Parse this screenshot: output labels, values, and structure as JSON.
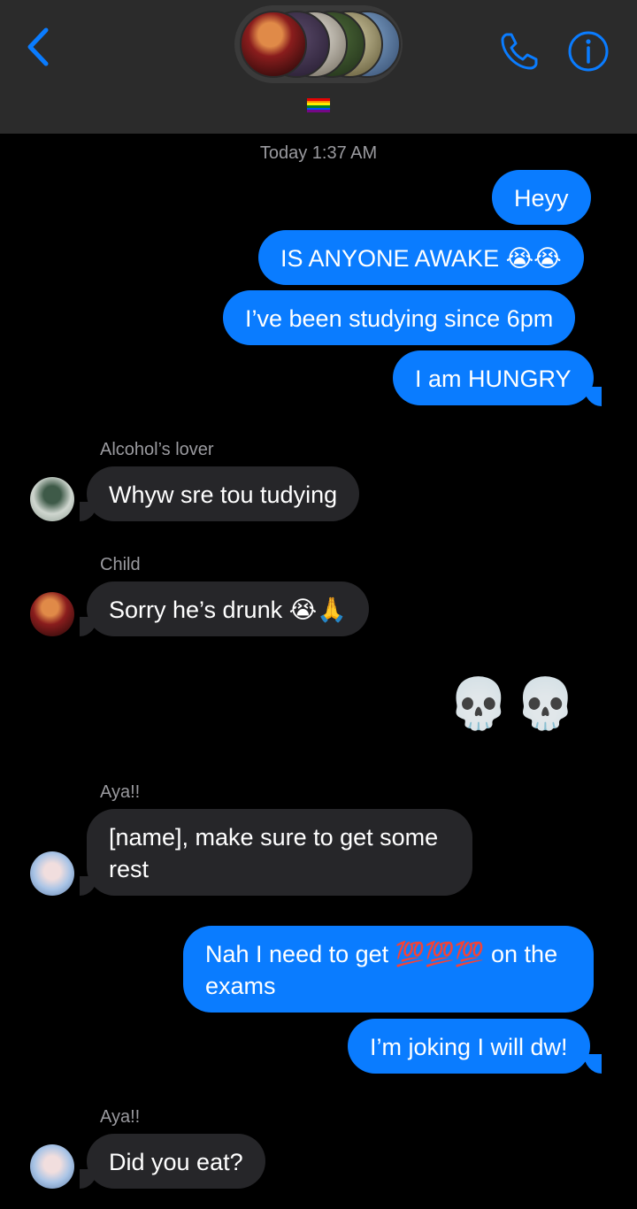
{
  "header": {
    "back_icon": "chevron-left-icon",
    "call_icon": "phone-icon",
    "info_icon": "info-icon",
    "accent_color": "#0a7cff",
    "flag_emoji": "rainbow-flag-icon"
  },
  "thread": {
    "timestamp": "Today 1:37 AM",
    "messages": [
      {
        "id": "m1",
        "direction": "outgoing",
        "text": "Heyy"
      },
      {
        "id": "m2",
        "direction": "outgoing",
        "text": "IS ANYONE AWAKE 😭😭"
      },
      {
        "id": "m3",
        "direction": "outgoing",
        "text": "I’ve been studying since 6pm"
      },
      {
        "id": "m4",
        "direction": "outgoing",
        "text": "I am HUNGRY"
      },
      {
        "id": "m5",
        "direction": "incoming",
        "sender": "Alcohol’s lover",
        "text": "Whyw sre tou tudying"
      },
      {
        "id": "m6",
        "direction": "incoming",
        "sender": "Child",
        "text": "Sorry he’s drunk 😭🙏"
      },
      {
        "id": "m7",
        "direction": "outgoing",
        "text": "💀💀"
      },
      {
        "id": "m8",
        "direction": "incoming",
        "sender": "Aya!!",
        "text": "[name], make sure to get some\nrest"
      },
      {
        "id": "m9",
        "direction": "outgoing",
        "text": "Nah I need to get 💯💯💯 on the\nexams"
      },
      {
        "id": "m10",
        "direction": "outgoing",
        "text": "I’m joking I will dw!"
      },
      {
        "id": "m11",
        "direction": "incoming",
        "sender": "Aya!!",
        "text": "Did you eat?"
      }
    ]
  }
}
